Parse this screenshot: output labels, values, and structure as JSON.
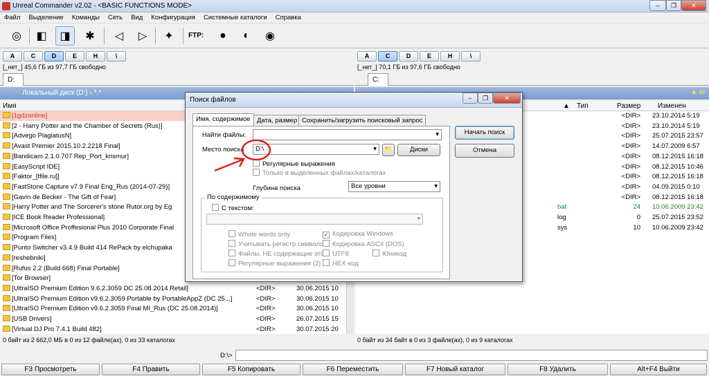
{
  "window": {
    "title": "Unreal Commander v2.02 - <BASIC FUNCTIONS MODE>"
  },
  "menu": [
    "Файл",
    "Выделение",
    "Команды",
    "Сеть",
    "Вид",
    "Конфигурация",
    "Системные каталоги",
    "Справка"
  ],
  "toolbar": {
    "ftp_label": "FTP:"
  },
  "drives": [
    "A",
    "C",
    "D",
    "E",
    "H",
    "\\"
  ],
  "left": {
    "free": "[_нет_]  45,6 ГБ из  97,7 ГБ свободно",
    "tab": "D:",
    "path": "Локальный диск (D:)  ›  *.*",
    "col_name": "Имя",
    "rows": [
      {
        "name": "[1gdzonline]",
        "size": "",
        "date": ""
      },
      {
        "name": "[2 - Harry Potter and the Chamber of Secrets (Rus)]",
        "size": "",
        "date": ""
      },
      {
        "name": "[Advego PlagiatusN]",
        "size": "",
        "date": ""
      },
      {
        "name": "[Avast Premier 2015.10.2.2218 Final]",
        "size": "",
        "date": ""
      },
      {
        "name": "[Bandicam 2.1.0.707 Rep_Port_krismur]",
        "size": "",
        "date": ""
      },
      {
        "name": "[EasyScript IDE]",
        "size": "",
        "date": ""
      },
      {
        "name": "[Faktor_[tfile.ru]]",
        "size": "",
        "date": ""
      },
      {
        "name": "[FastStone Capture v7.9 Final Eng_Rus (2014-07-29)]",
        "size": "",
        "date": ""
      },
      {
        "name": "[Gavin de Becker - The Gift of Fear]",
        "size": "",
        "date": ""
      },
      {
        "name": "[Harry Potter and The Sorcerer's stone Rutor.org by Eg",
        "size": "",
        "date": ""
      },
      {
        "name": "[ICE Book Reader Professional]",
        "size": "",
        "date": ""
      },
      {
        "name": "[Microsoft Office Proffesional Plus 2010 Corporate Final",
        "size": "",
        "date": ""
      },
      {
        "name": "[Program Files]",
        "size": "",
        "date": ""
      },
      {
        "name": "[Punto Switcher v3.4.9 Build 414 RePack by elchupaka",
        "size": "",
        "date": ""
      },
      {
        "name": "[reshebniki]",
        "size": "",
        "date": ""
      },
      {
        "name": "[Rufus 2.2 (Build 668) Final Portable]",
        "size": "",
        "date": ""
      },
      {
        "name": "[Tor Browser]",
        "size": "",
        "date": ""
      },
      {
        "name": "[UltraISO Premium Edition 9.6.2.3059 DC 25.08.2014 Retail]",
        "size": "<DIR>",
        "date": "30.06.2015 10"
      },
      {
        "name": "[UltraISO Premium Edition v9.6.2.3059  Portable by PortableAppZ (DC 25...]",
        "size": "<DIR>",
        "date": "30.06.2015 10"
      },
      {
        "name": "[UltraISO Premium Edition v9.6.2.3059 Final MI_Rus (DC 25.08.2014)]",
        "size": "<DIR>",
        "date": "30.06.2015 10"
      },
      {
        "name": "[USB Drivers]",
        "size": "<DIR>",
        "date": "26.07.2015 15"
      },
      {
        "name": "[Virtual DJ Pro 7.4.1 Build 482]",
        "size": "<DIR>",
        "date": "30.07.2015 20"
      }
    ],
    "status": "0 байт из 2 662,0 МБ в 0 из 12 файле(ах), 0 из 33 каталогах"
  },
  "right": {
    "free": "[_нет_]  70,1 ГБ из  97,6 ГБ свободно",
    "tab": "C:",
    "col_type": "Тип",
    "col_size": "Размер",
    "col_date": "Изменен",
    "rows": [
      {
        "ext": "",
        "size": "<DIR>",
        "date": "23.10.2014 5:19",
        "g": false
      },
      {
        "ext": "",
        "size": "<DIR>",
        "date": "23.10.2014 5:19",
        "g": false
      },
      {
        "ext": "",
        "size": "<DIR>",
        "date": "25.07.2015 23:57",
        "g": false
      },
      {
        "ext": "",
        "size": "<DIR>",
        "date": "14.07.2009 6:57",
        "g": false
      },
      {
        "ext": "",
        "size": "<DIR>",
        "date": "08.12.2015 16:18",
        "g": false
      },
      {
        "ext": "",
        "size": "<DIR>",
        "date": "08.12.2015 10:46",
        "g": false
      },
      {
        "ext": "",
        "size": "<DIR>",
        "date": "08.12.2015 16:18",
        "g": false
      },
      {
        "ext": "",
        "size": "<DIR>",
        "date": "04.09.2015 0:10",
        "g": false
      },
      {
        "ext": "",
        "size": "<DIR>",
        "date": "08.12.2015 16:18",
        "g": false
      },
      {
        "ext": "bat",
        "size": "24",
        "date": "10.06.2009 23:42",
        "g": true
      },
      {
        "ext": "log",
        "size": "0",
        "date": "25.07.2015 23:52",
        "g": false
      },
      {
        "ext": "sys",
        "size": "10",
        "date": "10.06.2009 23:42",
        "g": false
      }
    ],
    "status": "0 байт из 34 байт в 0 из 3 файле(ах), 0 из 9 каталогах"
  },
  "cmdline": {
    "prompt": "D:\\>"
  },
  "fkeys": [
    "F3 Просмотреть",
    "F4 Править",
    "F5 Копировать",
    "F6 Переместить",
    "F7 Новый каталог",
    "F8 Удалить",
    "Alt+F4 Выйти"
  ],
  "dialog": {
    "title": "Поиск файлов",
    "tabs": [
      "Имя, содержимое",
      "Дата, размер",
      "Сохранить/загрузить поисковый запрос"
    ],
    "find_label": "Найти файлы:",
    "find_value": "",
    "where_label": "Место поиска",
    "where_value": "D:\\",
    "disks_btn": "Диски",
    "start_btn": "Начать поиск",
    "cancel_btn": "Отмена",
    "regex": "Регулярные выражения",
    "only_selected": "Только в выделенных файлах/каталогах",
    "depth_label": "Глубина поиска",
    "depth_value": "Все уровни",
    "content_group": "По содержимому",
    "with_text": "С текстом:",
    "opts": {
      "whole": "Whole words only",
      "case": "Учитывать регистр символов",
      "notcontain": "Файлы, НЕ содержащие этот",
      "regex2": "Регулярные выражения (2)",
      "win": "Кодировка Windows",
      "dos": "Кодировка ASCII (DOS)",
      "utf8": "UTF8",
      "unicode": "Юникод",
      "hex": "HEX-код"
    }
  },
  "colors": {
    "annotation": "#d9231e",
    "accent": "#7c9ccf"
  }
}
